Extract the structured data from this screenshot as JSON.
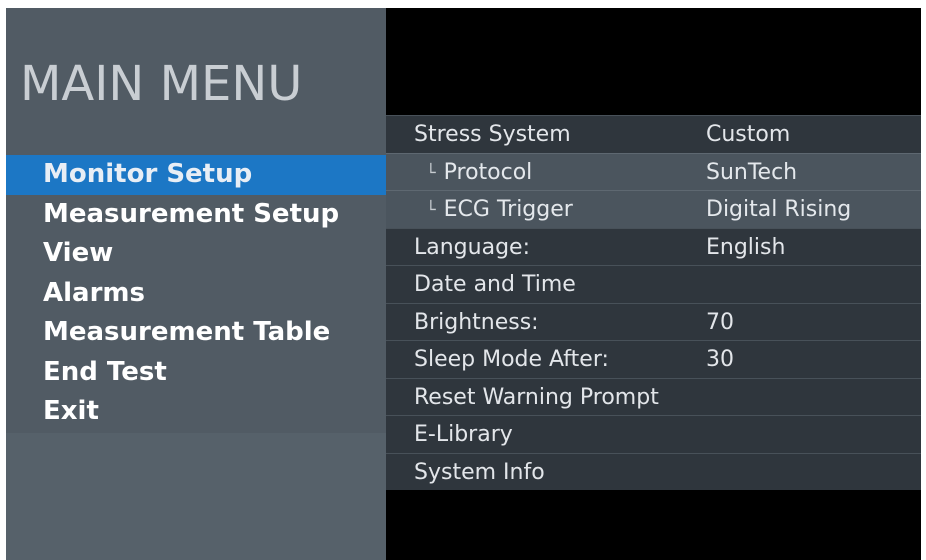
{
  "menu": {
    "title": "MAIN MENU",
    "items": [
      {
        "label": "Monitor Setup",
        "selected": true
      },
      {
        "label": "Measurement Setup",
        "selected": false
      },
      {
        "label": "View",
        "selected": false
      },
      {
        "label": "Alarms",
        "selected": false
      },
      {
        "label": "Measurement Table",
        "selected": false
      },
      {
        "label": "End Test",
        "selected": false
      },
      {
        "label": "Exit",
        "selected": false
      }
    ]
  },
  "settings": {
    "rows": [
      {
        "label": "Stress System",
        "value": "Custom"
      },
      {
        "label": "Protocol",
        "value": "SunTech",
        "tree_glyph": "└"
      },
      {
        "label": "ECG Trigger",
        "value": "Digital Rising",
        "tree_glyph": "└"
      },
      {
        "label": "Language:",
        "value": "English"
      },
      {
        "label": "Date and Time",
        "value": ""
      },
      {
        "label": "Brightness:",
        "value": "70"
      },
      {
        "label": "Sleep Mode After:",
        "value": "30"
      },
      {
        "label": "Reset Warning Prompt",
        "value": ""
      },
      {
        "label": "E-Library",
        "value": ""
      },
      {
        "label": "System Info",
        "value": ""
      }
    ]
  },
  "colors": {
    "selected_highlight": "#1c77c5",
    "menu_background": "#515b64",
    "row_background": "#2f363d",
    "subrow_background": "#4b555e"
  }
}
